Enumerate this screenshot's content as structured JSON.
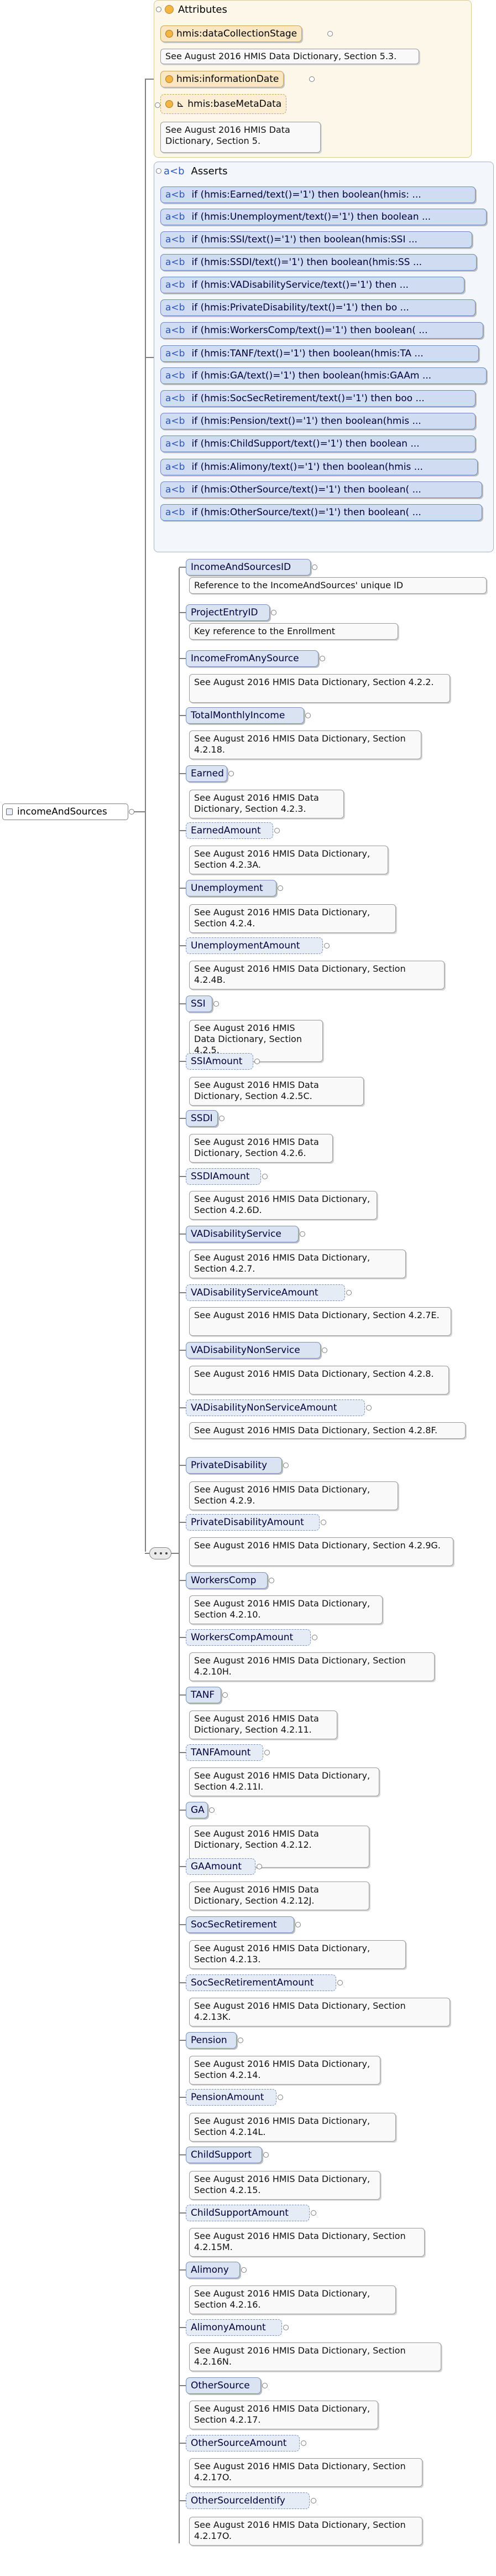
{
  "root": {
    "label": "incomeAndSources"
  },
  "attributes": {
    "heading": "Attributes",
    "items": [
      {
        "name": "hmis:dataCollectionStage",
        "doc": "See August 2016 HMIS Data Dictionary, Section 5.3."
      },
      {
        "name": "hmis:informationDate",
        "doc": ""
      },
      {
        "name": "hmis:baseMetaData",
        "doc": "See August 2016 HMIS Data Dictionary, Section 5."
      }
    ]
  },
  "asserts": {
    "heading": "Asserts",
    "tag": "a<b",
    "items": [
      "if (hmis:Earned/text()='1') then boolean(hmis: ...",
      "if (hmis:Unemployment/text()='1') then boolean ...",
      "if (hmis:SSI/text()='1') then boolean(hmis:SSI ...",
      "if (hmis:SSDI/text()='1') then boolean(hmis:SS ...",
      "if (hmis:VADisabilityService/text()='1') then  ...",
      "if (hmis:PrivateDisability/text()='1') then bo ...",
      "if (hmis:WorkersComp/text()='1') then boolean( ...",
      "if (hmis:TANF/text()='1') then boolean(hmis:TA ...",
      "if (hmis:GA/text()='1') then boolean(hmis:GAAm ...",
      "if (hmis:SocSecRetirement/text()='1') then boo ...",
      "if (hmis:Pension/text()='1') then boolean(hmis ...",
      "if (hmis:ChildSupport/text()='1') then boolean ...",
      "if (hmis:Alimony/text()='1') then boolean(hmis ...",
      "if (hmis:OtherSource/text()='1') then boolean( ...",
      "if (hmis:OtherSource/text()='1') then boolean( ..."
    ]
  },
  "elements": [
    {
      "name": "IncomeAndSourcesID",
      "doc": "Reference to the IncomeAndSources' unique ID"
    },
    {
      "name": "ProjectEntryID",
      "doc": "Key reference to the Enrollment"
    },
    {
      "name": "IncomeFromAnySource",
      "doc": "See August 2016 HMIS Data Dictionary, Section 4.2.2."
    },
    {
      "name": "TotalMonthlyIncome",
      "doc": "See August 2016 HMIS Data Dictionary, Section 4.2.18."
    },
    {
      "name": "Earned",
      "doc": "See August 2016 HMIS Data Dictionary, Section 4.2.3."
    },
    {
      "name": "EarnedAmount",
      "doc": "See August 2016 HMIS Data Dictionary, Section 4.2.3A."
    },
    {
      "name": "Unemployment",
      "doc": "See August 2016 HMIS Data Dictionary, Section 4.2.4."
    },
    {
      "name": "UnemploymentAmount",
      "doc": "See August 2016 HMIS Data Dictionary, Section 4.2.4B."
    },
    {
      "name": "SSI",
      "doc": "See August 2016 HMIS Data Dictionary, Section 4.2.5."
    },
    {
      "name": "SSIAmount",
      "doc": "See August 2016 HMIS Data Dictionary, Section 4.2.5C."
    },
    {
      "name": "SSDI",
      "doc": "See August 2016 HMIS Data Dictionary, Section 4.2.6."
    },
    {
      "name": "SSDIAmount",
      "doc": "See August 2016 HMIS Data Dictionary, Section 4.2.6D."
    },
    {
      "name": "VADisabilityService",
      "doc": "See August 2016 HMIS Data Dictionary, Section 4.2.7."
    },
    {
      "name": "VADisabilityServiceAmount",
      "doc": "See August 2016 HMIS Data Dictionary, Section 4.2.7E."
    },
    {
      "name": "VADisabilityNonService",
      "doc": "See August 2016 HMIS Data Dictionary, Section 4.2.8."
    },
    {
      "name": "VADisabilityNonServiceAmount",
      "doc": "See August 2016 HMIS Data Dictionary, Section 4.2.8F."
    },
    {
      "name": "PrivateDisability",
      "doc": "See August 2016 HMIS Data Dictionary, Section 4.2.9."
    },
    {
      "name": "PrivateDisabilityAmount",
      "doc": "See August 2016 HMIS Data Dictionary, Section 4.2.9G."
    },
    {
      "name": "WorkersComp",
      "doc": "See August 2016 HMIS Data Dictionary, Section 4.2.10."
    },
    {
      "name": "WorkersCompAmount",
      "doc": "See August 2016 HMIS Data Dictionary, Section 4.2.10H."
    },
    {
      "name": "TANF",
      "doc": "See August 2016 HMIS Data Dictionary, Section 4.2.11."
    },
    {
      "name": "TANFAmount",
      "doc": "See August 2016 HMIS Data Dictionary, Section 4.2.11I."
    },
    {
      "name": "GA",
      "doc": "See August 2016 HMIS Data Dictionary, Section 4.2.12."
    },
    {
      "name": "GAAmount",
      "doc": "See August 2016 HMIS Data Dictionary, Section 4.2.12J."
    },
    {
      "name": "SocSecRetirement",
      "doc": "See August 2016 HMIS Data Dictionary, Section 4.2.13."
    },
    {
      "name": "SocSecRetirementAmount",
      "doc": "See August 2016 HMIS Data Dictionary, Section 4.2.13K."
    },
    {
      "name": "Pension",
      "doc": "See August 2016 HMIS Data Dictionary, Section 4.2.14."
    },
    {
      "name": "PensionAmount",
      "doc": "See August 2016 HMIS Data Dictionary, Section 4.2.14L."
    },
    {
      "name": "ChildSupport",
      "doc": "See August 2016 HMIS Data Dictionary, Section 4.2.15."
    },
    {
      "name": "ChildSupportAmount",
      "doc": "See August 2016 HMIS Data Dictionary, Section 4.2.15M."
    },
    {
      "name": "Alimony",
      "doc": "See August 2016 HMIS Data Dictionary, Section 4.2.16."
    },
    {
      "name": "AlimonyAmount",
      "doc": "See August 2016 HMIS Data Dictionary, Section 4.2.16N."
    },
    {
      "name": "OtherSource",
      "doc": "See August 2016 HMIS Data Dictionary, Section 4.2.17."
    },
    {
      "name": "OtherSourceAmount",
      "doc": "See August 2016 HMIS Data Dictionary, Section 4.2.17O."
    },
    {
      "name": "OtherSourceIdentify",
      "doc": "See August 2016 HMIS Data Dictionary, Section 4.2.17O."
    }
  ]
}
